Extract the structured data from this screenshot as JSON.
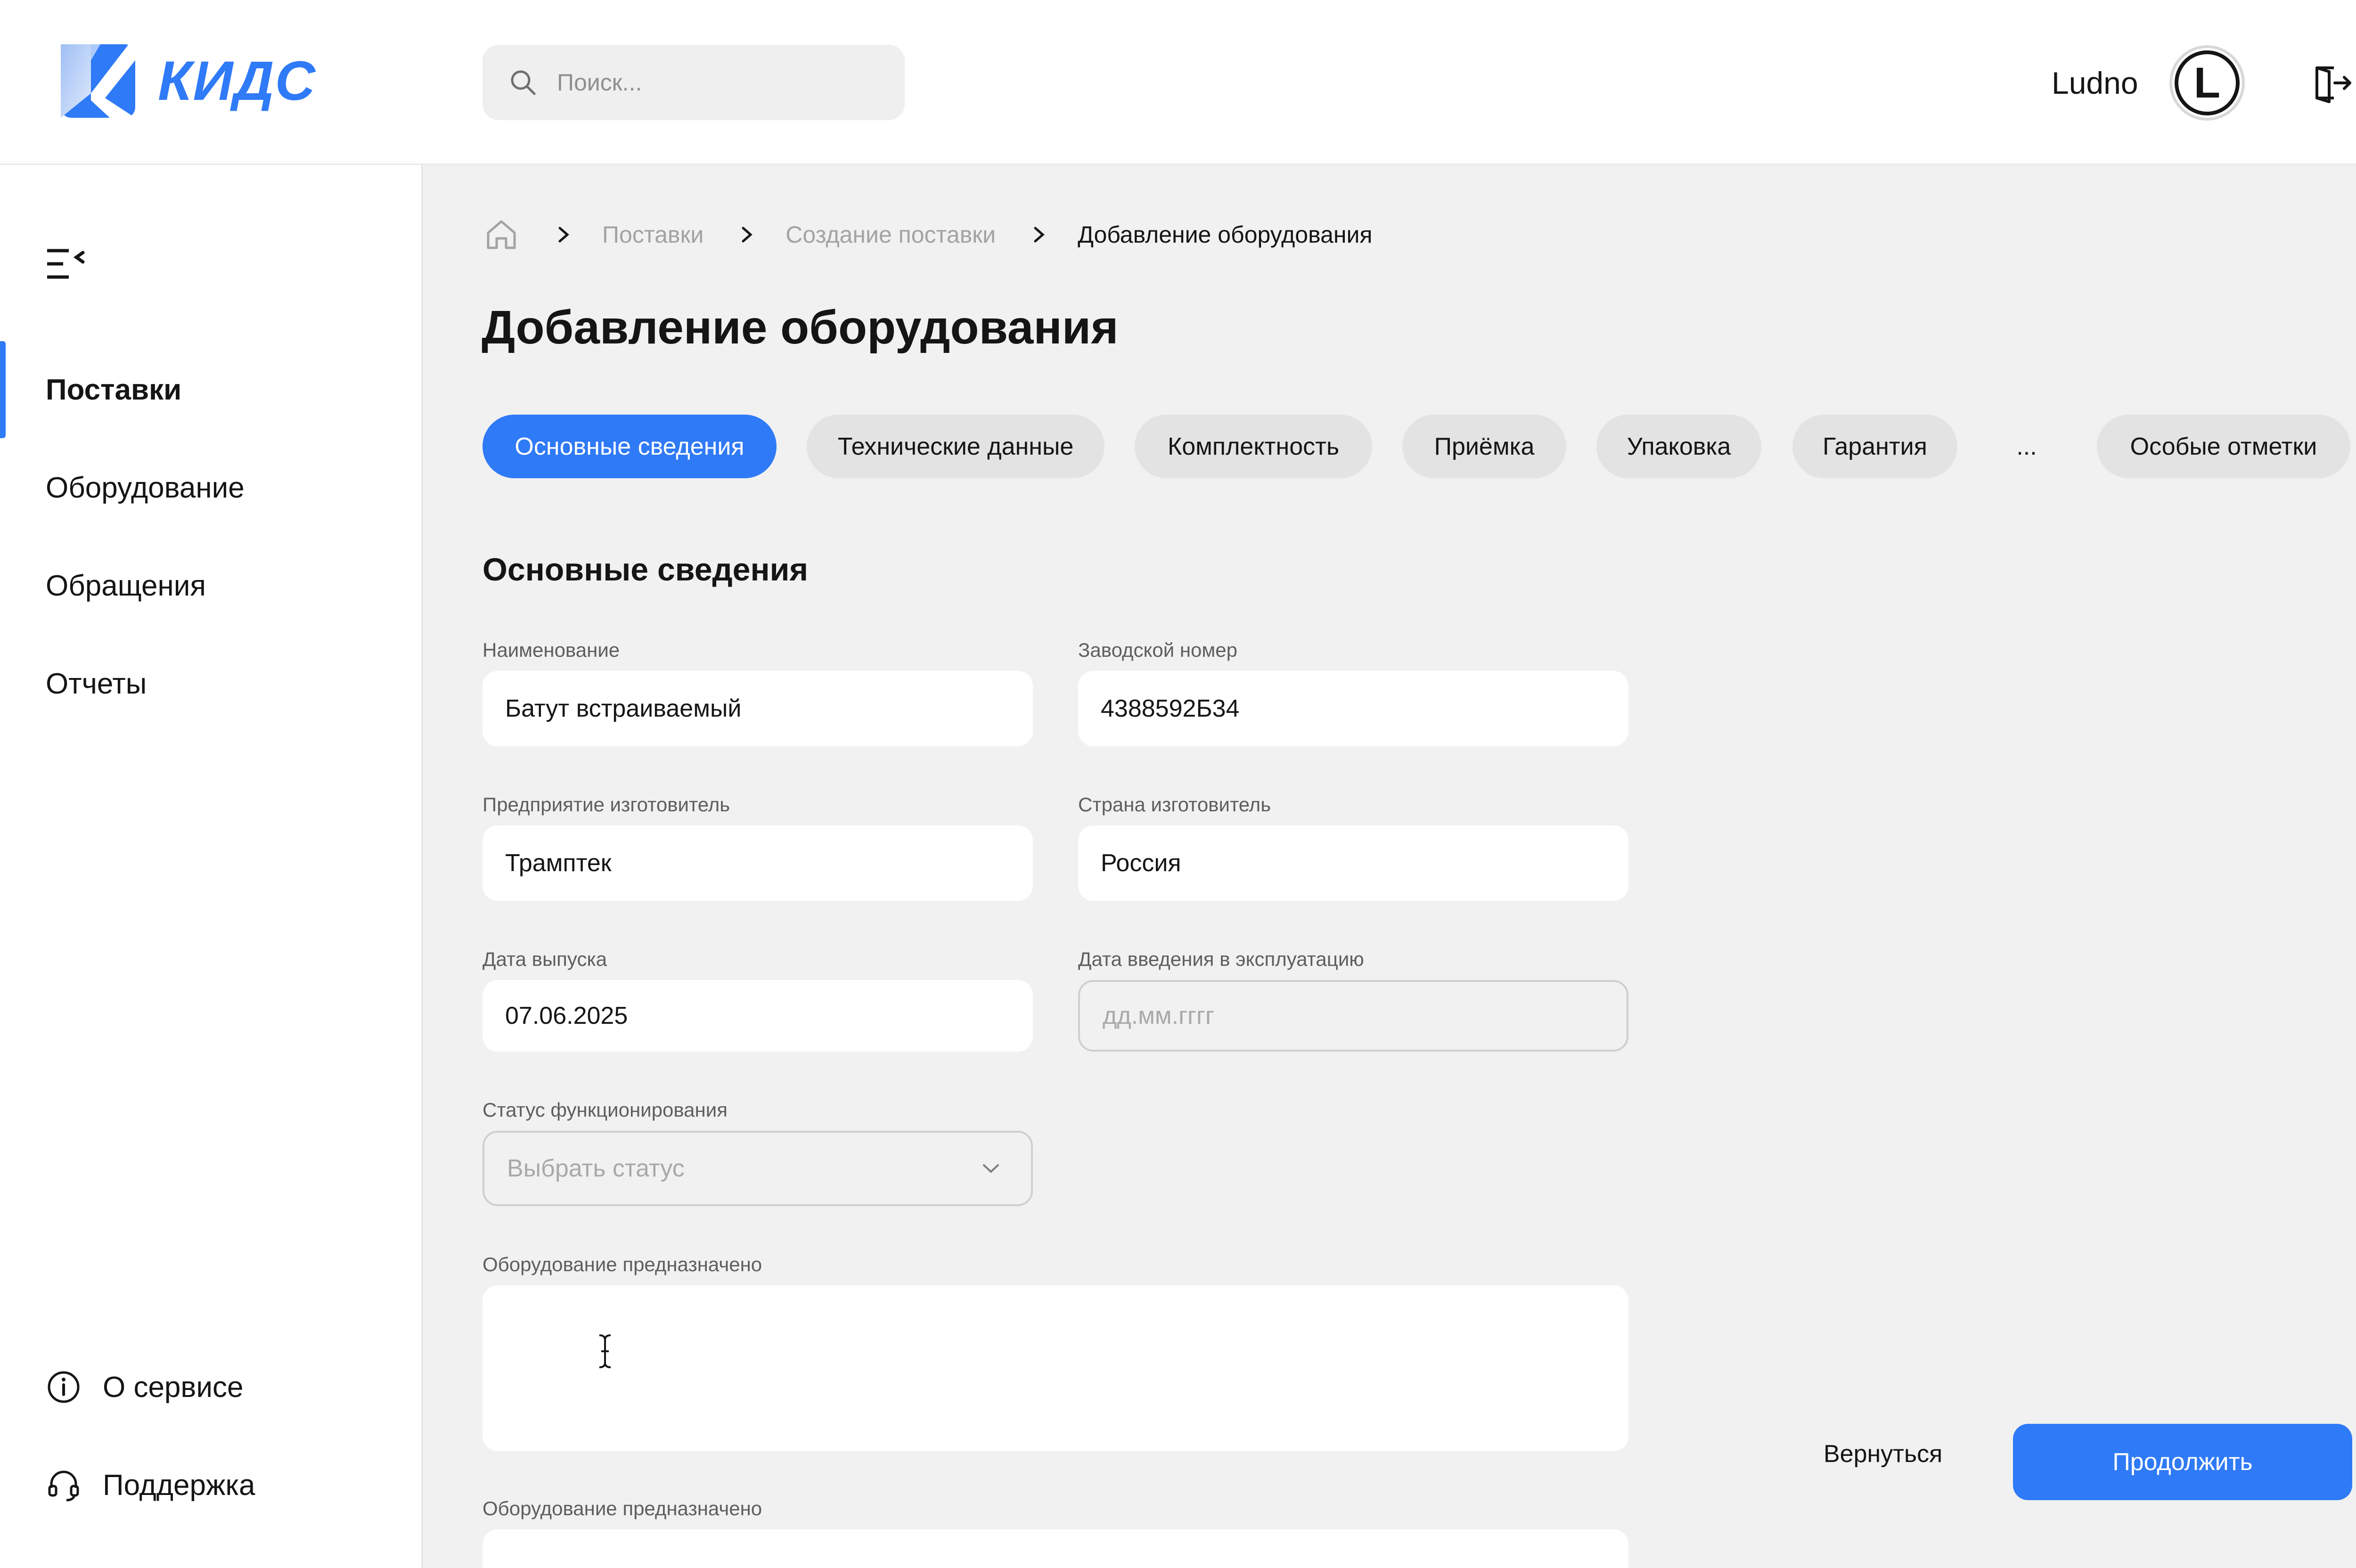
{
  "brand": {
    "name": "КИДС",
    "accent": "#2f7af6"
  },
  "search": {
    "placeholder": "Поиск..."
  },
  "user": {
    "name": "Ludno",
    "initial": "L"
  },
  "sidebar": {
    "items": [
      {
        "label": "Поставки",
        "active": true
      },
      {
        "label": "Оборудование",
        "active": false
      },
      {
        "label": "Обращения",
        "active": false
      },
      {
        "label": "Отчеты",
        "active": false
      }
    ],
    "bottom": [
      {
        "label": "О сервисе",
        "icon": "info-icon"
      },
      {
        "label": "Поддержка",
        "icon": "headset-icon"
      }
    ]
  },
  "breadcrumbs": {
    "items": [
      "Поставки",
      "Создание поставки",
      "Добавление оборудования"
    ]
  },
  "page": {
    "title": "Добавление оборудования"
  },
  "tabs": [
    {
      "label": "Основные сведения",
      "active": true
    },
    {
      "label": "Технические данные"
    },
    {
      "label": "Комплектность"
    },
    {
      "label": "Приёмка"
    },
    {
      "label": "Упаковка"
    },
    {
      "label": "Гарантия"
    },
    {
      "label": "..."
    },
    {
      "label": "Особые отметки"
    }
  ],
  "form": {
    "section_title": "Основные сведения",
    "name": {
      "label": "Наименование",
      "value": "Батут встраиваемый"
    },
    "serial": {
      "label": "Заводской номер",
      "value": "4388592Б34"
    },
    "manufacturer": {
      "label": "Предприятие изготовитель",
      "value": "Трамптек"
    },
    "country": {
      "label": "Страна изготовитель",
      "value": "Россия"
    },
    "release_date": {
      "label": "Дата выпуска",
      "value": "07.06.2025"
    },
    "commission_date": {
      "label": "Дата введения в эксплуатацию",
      "placeholder": "дд.мм.гггг"
    },
    "status": {
      "label": "Статус функционирования",
      "placeholder": "Выбрать статус"
    },
    "purpose1": {
      "label": "Оборудование предназначено",
      "value": ""
    },
    "purpose2": {
      "label": "Оборудование предназначено",
      "value": ""
    }
  },
  "actions": {
    "back": "Вернуться",
    "continue": "Продолжить"
  }
}
